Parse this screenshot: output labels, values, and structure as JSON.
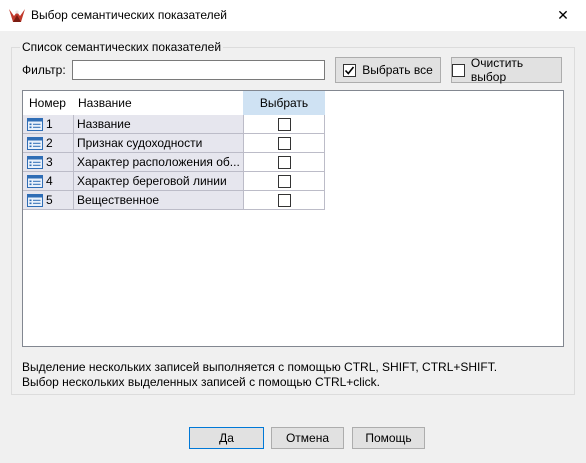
{
  "window": {
    "title": "Выбор семантических показателей",
    "close_glyph": "✕"
  },
  "group": {
    "title": "Список семантических показателей",
    "filter_label": "Фильтр:",
    "filter_value": "",
    "select_all_label": "Выбрать все",
    "select_all_checked": true,
    "clear_selection_label": "Очистить выбор",
    "clear_selection_checked": false
  },
  "table": {
    "columns": [
      "Номер",
      "Название",
      "Выбрать"
    ],
    "rows": [
      {
        "number": "1",
        "name": "Название",
        "selected": false
      },
      {
        "number": "2",
        "name": "Признак судоходности",
        "selected": false
      },
      {
        "number": "3",
        "name": "Характер расположения об...",
        "selected": false
      },
      {
        "number": "4",
        "name": "Характер береговой линии",
        "selected": false
      },
      {
        "number": "5",
        "name": "Вещественное",
        "selected": false
      }
    ]
  },
  "hints": {
    "line1": "Выделение нескольких записей выполняется с помощью CTRL, SHIFT, CTRL+SHIFT.",
    "line2": "Выбор нескольких выделенных записей с помощью CTRL+click."
  },
  "buttons": {
    "ok": "Да",
    "cancel": "Отмена",
    "help": "Помощь"
  },
  "icons": {
    "app": "map-app-icon",
    "row": "record-icon",
    "close": "close-icon"
  }
}
